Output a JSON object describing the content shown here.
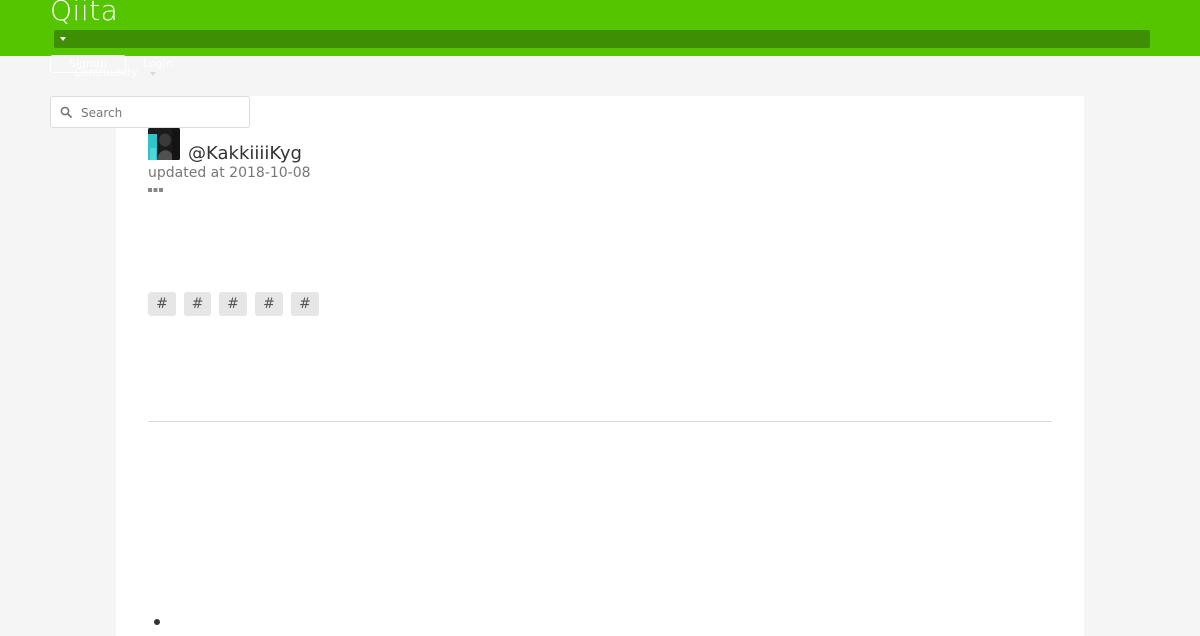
{
  "header": {
    "logo_text": "Qiita",
    "brand_color": "#55c500",
    "signup_label": "Signup",
    "login_label": "Login",
    "community_label": "Community"
  },
  "search": {
    "placeholder": "Search",
    "value": ""
  },
  "article": {
    "username": "@KakkiiiiKyg",
    "updated_at": "updated at 2018-10-08",
    "tags": [
      {
        "label": "#"
      },
      {
        "label": "#"
      },
      {
        "label": "#"
      },
      {
        "label": "#"
      },
      {
        "label": "#"
      }
    ]
  },
  "icons": {
    "search": "search-icon",
    "caret": "caret-down-icon",
    "more": "more-icon"
  }
}
